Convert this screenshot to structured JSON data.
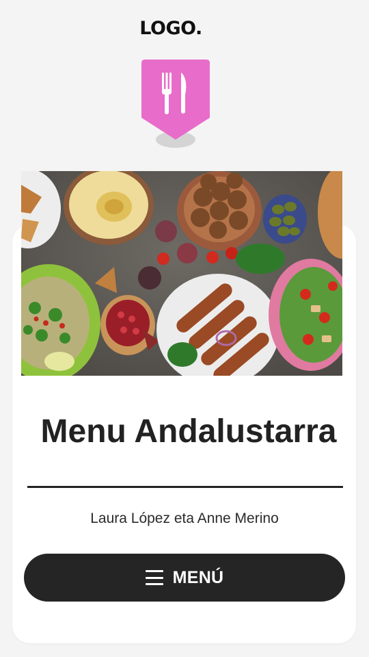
{
  "header": {
    "logo_text": "LOGO."
  },
  "badge": {
    "icon": "fork-knife-icon",
    "color": "#e86cc9"
  },
  "hero": {
    "alt": "Mezze"
  },
  "main": {
    "title": "Menu Andalustarra",
    "authors": "Laura López eta Anne Merino"
  },
  "menu_button": {
    "label": "MENÚ",
    "icon": "hamburger-icon"
  },
  "colors": {
    "accent": "#e86cc9",
    "text": "#222222",
    "button_bg": "#252525",
    "background": "#f4f4f4"
  }
}
